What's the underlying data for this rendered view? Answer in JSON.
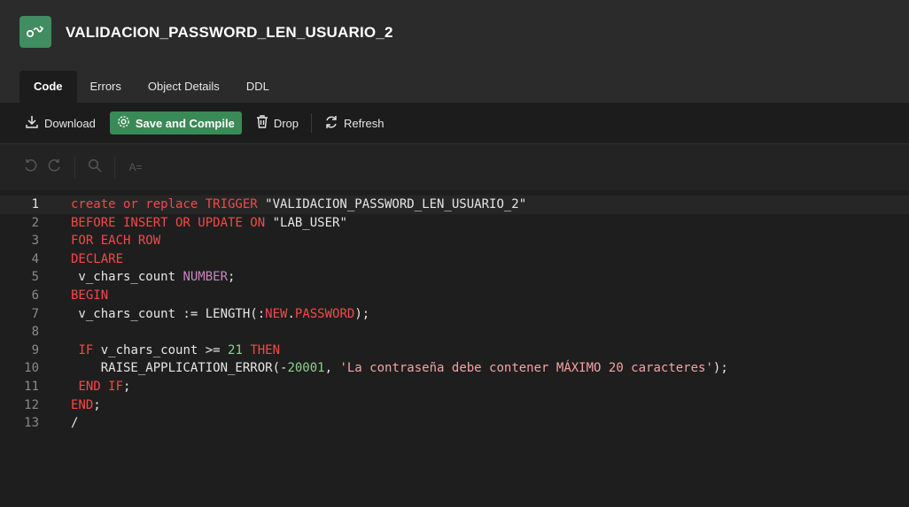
{
  "header": {
    "title": "VALIDACION_PASSWORD_LEN_USUARIO_2",
    "icon": "trigger-icon"
  },
  "tabs": [
    {
      "label": "Code",
      "active": true
    },
    {
      "label": "Errors",
      "active": false
    },
    {
      "label": "Object Details",
      "active": false
    },
    {
      "label": "DDL",
      "active": false
    }
  ],
  "toolbar": {
    "download_label": "Download",
    "save_compile_label": "Save and Compile",
    "drop_label": "Drop",
    "refresh_label": "Refresh"
  },
  "editor_toolbar": {
    "format_label": "A="
  },
  "code": {
    "lines": [
      {
        "num": "1",
        "tokens": [
          {
            "t": "create or replace TRIGGER",
            "c": "kw"
          },
          {
            "t": " \"VALIDACION_PASSWORD_LEN_USUARIO_2\"",
            "c": "plain"
          }
        ]
      },
      {
        "num": "2",
        "tokens": [
          {
            "t": "BEFORE INSERT OR UPDATE ON",
            "c": "kw"
          },
          {
            "t": " \"LAB_USER\"",
            "c": "plain"
          }
        ]
      },
      {
        "num": "3",
        "tokens": [
          {
            "t": "FOR EACH ROW",
            "c": "kw"
          }
        ]
      },
      {
        "num": "4",
        "tokens": [
          {
            "t": "DECLARE",
            "c": "kw"
          }
        ]
      },
      {
        "num": "5",
        "tokens": [
          {
            "t": " v_chars_count ",
            "c": "plain"
          },
          {
            "t": "NUMBER",
            "c": "type"
          },
          {
            "t": ";",
            "c": "plain"
          }
        ]
      },
      {
        "num": "6",
        "tokens": [
          {
            "t": "BEGIN",
            "c": "kw"
          }
        ]
      },
      {
        "num": "7",
        "tokens": [
          {
            "t": " v_chars_count := LENGTH(:",
            "c": "plain"
          },
          {
            "t": "NEW",
            "c": "kw"
          },
          {
            "t": ".",
            "c": "plain"
          },
          {
            "t": "PASSWORD",
            "c": "kw"
          },
          {
            "t": ");",
            "c": "plain"
          }
        ]
      },
      {
        "num": "8",
        "tokens": []
      },
      {
        "num": "9",
        "tokens": [
          {
            "t": " ",
            "c": "plain"
          },
          {
            "t": "IF",
            "c": "kw"
          },
          {
            "t": " v_chars_count >= ",
            "c": "plain"
          },
          {
            "t": "21",
            "c": "num"
          },
          {
            "t": " ",
            "c": "plain"
          },
          {
            "t": "THEN",
            "c": "kw"
          }
        ]
      },
      {
        "num": "10",
        "tokens": [
          {
            "t": "    RAISE_APPLICATION_ERROR(-",
            "c": "plain"
          },
          {
            "t": "20001",
            "c": "num"
          },
          {
            "t": ", ",
            "c": "plain"
          },
          {
            "t": "'La contraseña debe contener MÁXIMO 20 caracteres'",
            "c": "str"
          },
          {
            "t": ");",
            "c": "plain"
          }
        ]
      },
      {
        "num": "11",
        "tokens": [
          {
            "t": " ",
            "c": "plain"
          },
          {
            "t": "END IF",
            "c": "kw"
          },
          {
            "t": ";",
            "c": "plain"
          }
        ]
      },
      {
        "num": "12",
        "tokens": [
          {
            "t": "END",
            "c": "kw"
          },
          {
            "t": ";",
            "c": "plain"
          }
        ]
      },
      {
        "num": "13",
        "tokens": [
          {
            "t": "/",
            "c": "plain"
          }
        ]
      }
    ],
    "current_line": "1"
  }
}
